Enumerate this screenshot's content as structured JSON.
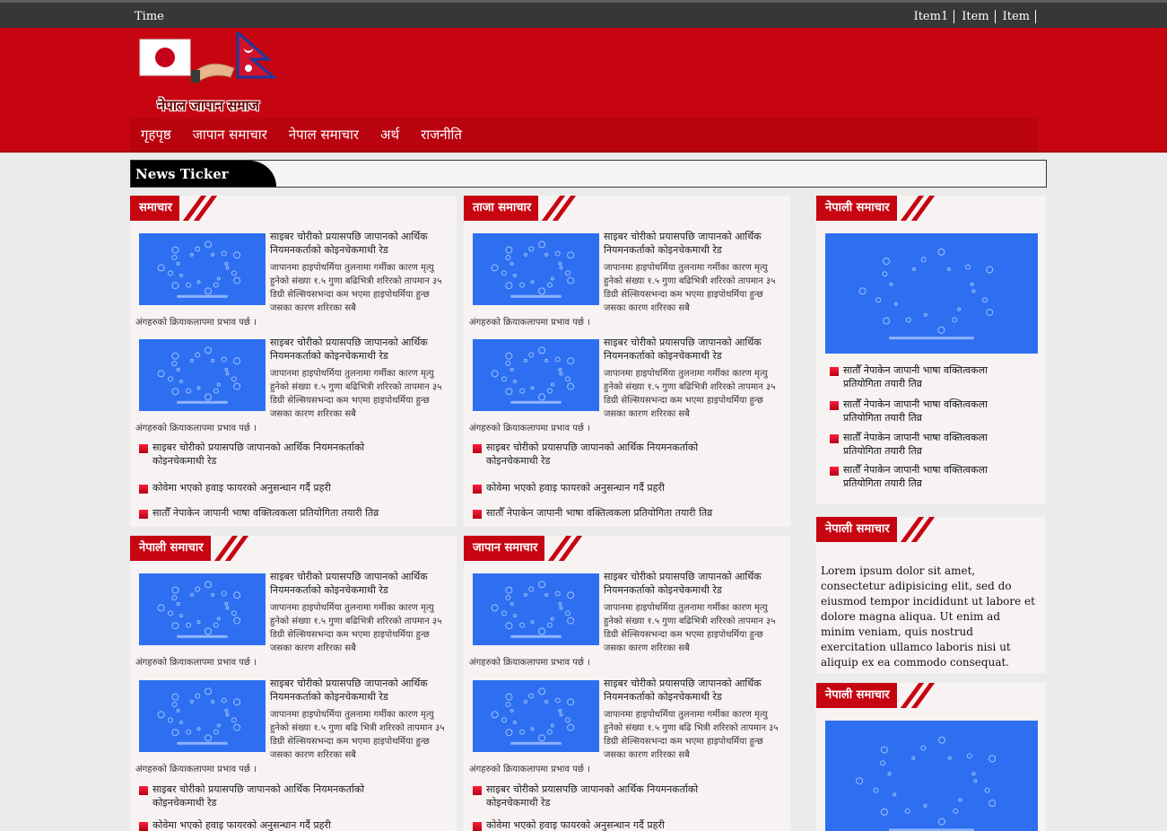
{
  "topbar": {
    "time": "Time",
    "links": [
      "Item1",
      "Item",
      "Item"
    ]
  },
  "logo": {
    "text": "नेपाल जापान समाज"
  },
  "nav": [
    "गृहपृष्ठ",
    "जापान समाचार",
    "नेपाल समाचार",
    "अर्थ",
    "राजनीति"
  ],
  "ticker": {
    "label": "News Ticker"
  },
  "article": {
    "title": "साइबर चोरीको प्रयासपछि जापानको आर्थिक नियमनकर्ताको कोइनचेकमाथी रेड",
    "body": "जापानमा हाइपोथर्मिया तुलनामा गर्मीका कारण मृत्यु हुनेको संख्या १.५ गुणा बढिभित्री शरिरको तापमान ३५ डिग्री सेल्सियसभन्दा कम भएमा हाइपोथर्मिया हुन्छ जसका कारण शरिरका सबै",
    "body_alt": "जापानमा हाइपोथर्मिया तुलनामा गर्मीका कारण मृत्यु हुनेको संख्या १.५ गुणा बढि भित्री शरिरको तापमान ३५ डिग्री सेल्सियसभन्दा कम भएमा हाइपोथर्मिया हुन्छ जसका कारण शरिरका सबै",
    "tail": "अंगहरुको क्रियाकलापमा प्रभाव पर्छ ।"
  },
  "list": [
    "साइबर चोरीको प्रयासपछि जापानको आर्थिक नियमनकर्ताको कोइनचेकमाथी रेड",
    "कोवेमा भएको हवाइ फायरको अनुसन्धान गर्दै प्रहरी",
    "सातौँ नेपाकेन जापानी भाषा वक्तित्वकला प्रतियोगिता तयारी तिव्र"
  ],
  "sections": {
    "s1": "समाचार",
    "s2": "ताजा समाचार",
    "s3": "नेपाली समाचार",
    "s4": "जापान समाचार",
    "r1": "नेपाली समाचार",
    "r2": "नेपाली समाचार",
    "r3": "नेपाली समाचार"
  },
  "sidebar": {
    "items": [
      "सातौँ नेपाकेन जापानी भाषा वक्तित्वकला प्रतियोगिता तयारी तिव्र",
      "सातौँ नेपाकेन जापानी भाषा वक्तित्वकला प्रतियोगिता तयारी तिव्र",
      "सातौँ नेपाकेन जापानी भाषा वक्तित्वकला प्रतियोगिता तयारी तिव्र",
      "सातौँ नेपाकेन जापानी भाषा वक्तित्वकला प्रतियोगिता तयारी तिव्र"
    ],
    "lorem": "Lorem ipsum dolor sit amet, consectetur adipisicing elit, sed do eiusmod tempor incididunt ut labore et dolore magna aliqua. Ut enim ad minim veniam, quis nostrud exercitation ullamco laboris nisi ut aliquip ex ea commodo consequat."
  },
  "colors": {
    "brand_red": "#c70511",
    "thumb_blue": "#2d6ff0",
    "topbar": "#373737"
  }
}
